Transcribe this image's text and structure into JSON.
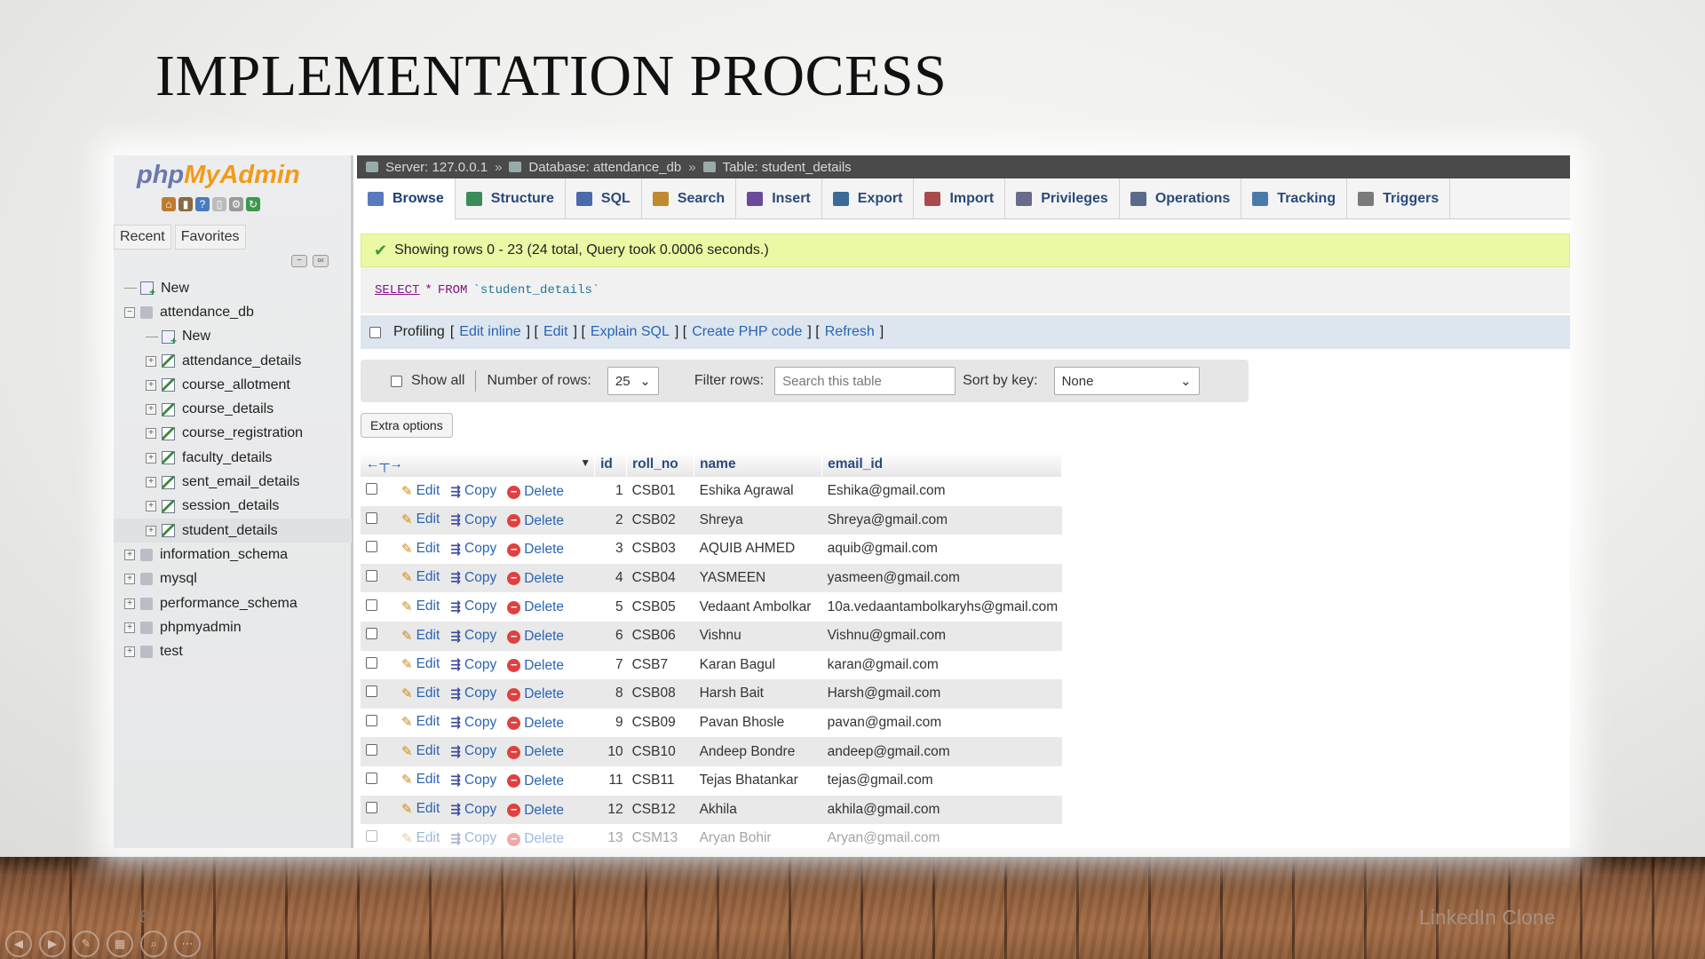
{
  "slide": {
    "title": "IMPLEMENTATION PROCESS",
    "number": "8",
    "footer": "LinkedIn Clone"
  },
  "sidebar": {
    "logo_php": "php",
    "logo_admin": "MyAdmin",
    "tabs": [
      "Recent",
      "Favorites"
    ],
    "tree": [
      {
        "label": "New",
        "level": 0,
        "type": "new"
      },
      {
        "label": "attendance_db",
        "level": 0,
        "type": "db"
      },
      {
        "label": "New",
        "level": 1,
        "type": "new"
      },
      {
        "label": "attendance_details",
        "level": 1,
        "type": "table"
      },
      {
        "label": "course_allotment",
        "level": 1,
        "type": "table"
      },
      {
        "label": "course_details",
        "level": 1,
        "type": "table"
      },
      {
        "label": "course_registration",
        "level": 1,
        "type": "table"
      },
      {
        "label": "faculty_details",
        "level": 1,
        "type": "table"
      },
      {
        "label": "sent_email_details",
        "level": 1,
        "type": "table"
      },
      {
        "label": "session_details",
        "level": 1,
        "type": "table"
      },
      {
        "label": "student_details",
        "level": 1,
        "type": "table",
        "selected": true
      },
      {
        "label": "information_schema",
        "level": 0,
        "type": "db"
      },
      {
        "label": "mysql",
        "level": 0,
        "type": "db"
      },
      {
        "label": "performance_schema",
        "level": 0,
        "type": "db"
      },
      {
        "label": "phpmyadmin",
        "level": 0,
        "type": "db"
      },
      {
        "label": "test",
        "level": 0,
        "type": "db"
      }
    ]
  },
  "breadcrumb": {
    "server": "Server: 127.0.0.1",
    "database": "Database: attendance_db",
    "table": "Table: student_details",
    "separator": "»"
  },
  "tabs": [
    "Browse",
    "Structure",
    "SQL",
    "Search",
    "Insert",
    "Export",
    "Import",
    "Privileges",
    "Operations",
    "Tracking",
    "Triggers"
  ],
  "tab_colors": [
    "#5a7abf",
    "#3a8a5a",
    "#4a6aaa",
    "#c08a30",
    "#6a4a9a",
    "#3a6a9a",
    "#aa4a4a",
    "#6a6a8a",
    "#5a6a8a",
    "#4a7aaa",
    "#7a7a7a"
  ],
  "success": {
    "message": "Showing rows 0 - 23 (24 total, Query took 0.0006 seconds.)"
  },
  "sql": {
    "select": "SELECT",
    "star": "*",
    "from": "FROM",
    "table": "`student_details`"
  },
  "profiling": {
    "label": "Profiling",
    "links": [
      "Edit inline",
      "Edit",
      "Explain SQL",
      "Create PHP code",
      "Refresh"
    ]
  },
  "navigation": {
    "show_all": "Show all",
    "rows_label": "Number of rows:",
    "rows_value": "25",
    "filter_label": "Filter rows:",
    "filter_placeholder": "Search this table",
    "sort_label": "Sort by key:",
    "sort_value": "None"
  },
  "extra_options": "Extra options",
  "table": {
    "columns": [
      "id",
      "roll_no",
      "name",
      "email_id"
    ],
    "actions": {
      "edit": "Edit",
      "copy": "Copy",
      "delete": "Delete"
    },
    "rows": [
      {
        "id": "1",
        "roll_no": "CSB01",
        "name": "Eshika Agrawal",
        "email_id": "Eshika@gmail.com"
      },
      {
        "id": "2",
        "roll_no": "CSB02",
        "name": "Shreya",
        "email_id": "Shreya@gmail.com"
      },
      {
        "id": "3",
        "roll_no": "CSB03",
        "name": "AQUIB AHMED",
        "email_id": "aquib@gmail.com"
      },
      {
        "id": "4",
        "roll_no": "CSB04",
        "name": "YASMEEN",
        "email_id": "yasmeen@gmail.com"
      },
      {
        "id": "5",
        "roll_no": "CSB05",
        "name": "Vedaant Ambolkar",
        "email_id": "10a.vedaantambolkaryhs@gmail.com"
      },
      {
        "id": "6",
        "roll_no": "CSB06",
        "name": "Vishnu",
        "email_id": "Vishnu@gmail.com"
      },
      {
        "id": "7",
        "roll_no": "CSB7",
        "name": "Karan Bagul",
        "email_id": "karan@gmail.com"
      },
      {
        "id": "8",
        "roll_no": "CSB08",
        "name": "Harsh Bait",
        "email_id": "Harsh@gmail.com"
      },
      {
        "id": "9",
        "roll_no": "CSB09",
        "name": "Pavan Bhosle",
        "email_id": "pavan@gmail.com"
      },
      {
        "id": "10",
        "roll_no": "CSB10",
        "name": "Andeep Bondre",
        "email_id": "andeep@gmail.com"
      },
      {
        "id": "11",
        "roll_no": "CSB11",
        "name": "Tejas Bhatankar",
        "email_id": "tejas@gmail.com"
      },
      {
        "id": "12",
        "roll_no": "CSB12",
        "name": "Akhila",
        "email_id": "akhila@gmail.com"
      },
      {
        "id": "13",
        "roll_no": "CSM13",
        "name": "Aryan Bohir",
        "email_id": "Aryan@gmail.com"
      }
    ]
  }
}
